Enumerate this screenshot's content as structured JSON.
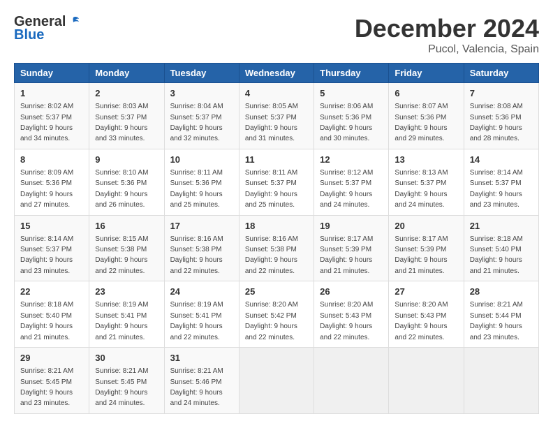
{
  "header": {
    "logo_general": "General",
    "logo_blue": "Blue",
    "month": "December 2024",
    "location": "Pucol, Valencia, Spain"
  },
  "days_of_week": [
    "Sunday",
    "Monday",
    "Tuesday",
    "Wednesday",
    "Thursday",
    "Friday",
    "Saturday"
  ],
  "weeks": [
    [
      {
        "day": "1",
        "sunrise": "8:02 AM",
        "sunset": "5:37 PM",
        "daylight": "9 hours and 34 minutes."
      },
      {
        "day": "2",
        "sunrise": "8:03 AM",
        "sunset": "5:37 PM",
        "daylight": "9 hours and 33 minutes."
      },
      {
        "day": "3",
        "sunrise": "8:04 AM",
        "sunset": "5:37 PM",
        "daylight": "9 hours and 32 minutes."
      },
      {
        "day": "4",
        "sunrise": "8:05 AM",
        "sunset": "5:37 PM",
        "daylight": "9 hours and 31 minutes."
      },
      {
        "day": "5",
        "sunrise": "8:06 AM",
        "sunset": "5:36 PM",
        "daylight": "9 hours and 30 minutes."
      },
      {
        "day": "6",
        "sunrise": "8:07 AM",
        "sunset": "5:36 PM",
        "daylight": "9 hours and 29 minutes."
      },
      {
        "day": "7",
        "sunrise": "8:08 AM",
        "sunset": "5:36 PM",
        "daylight": "9 hours and 28 minutes."
      }
    ],
    [
      {
        "day": "8",
        "sunrise": "8:09 AM",
        "sunset": "5:36 PM",
        "daylight": "9 hours and 27 minutes."
      },
      {
        "day": "9",
        "sunrise": "8:10 AM",
        "sunset": "5:36 PM",
        "daylight": "9 hours and 26 minutes."
      },
      {
        "day": "10",
        "sunrise": "8:11 AM",
        "sunset": "5:36 PM",
        "daylight": "9 hours and 25 minutes."
      },
      {
        "day": "11",
        "sunrise": "8:11 AM",
        "sunset": "5:37 PM",
        "daylight": "9 hours and 25 minutes."
      },
      {
        "day": "12",
        "sunrise": "8:12 AM",
        "sunset": "5:37 PM",
        "daylight": "9 hours and 24 minutes."
      },
      {
        "day": "13",
        "sunrise": "8:13 AM",
        "sunset": "5:37 PM",
        "daylight": "9 hours and 24 minutes."
      },
      {
        "day": "14",
        "sunrise": "8:14 AM",
        "sunset": "5:37 PM",
        "daylight": "9 hours and 23 minutes."
      }
    ],
    [
      {
        "day": "15",
        "sunrise": "8:14 AM",
        "sunset": "5:37 PM",
        "daylight": "9 hours and 23 minutes."
      },
      {
        "day": "16",
        "sunrise": "8:15 AM",
        "sunset": "5:38 PM",
        "daylight": "9 hours and 22 minutes."
      },
      {
        "day": "17",
        "sunrise": "8:16 AM",
        "sunset": "5:38 PM",
        "daylight": "9 hours and 22 minutes."
      },
      {
        "day": "18",
        "sunrise": "8:16 AM",
        "sunset": "5:38 PM",
        "daylight": "9 hours and 22 minutes."
      },
      {
        "day": "19",
        "sunrise": "8:17 AM",
        "sunset": "5:39 PM",
        "daylight": "9 hours and 21 minutes."
      },
      {
        "day": "20",
        "sunrise": "8:17 AM",
        "sunset": "5:39 PM",
        "daylight": "9 hours and 21 minutes."
      },
      {
        "day": "21",
        "sunrise": "8:18 AM",
        "sunset": "5:40 PM",
        "daylight": "9 hours and 21 minutes."
      }
    ],
    [
      {
        "day": "22",
        "sunrise": "8:18 AM",
        "sunset": "5:40 PM",
        "daylight": "9 hours and 21 minutes."
      },
      {
        "day": "23",
        "sunrise": "8:19 AM",
        "sunset": "5:41 PM",
        "daylight": "9 hours and 21 minutes."
      },
      {
        "day": "24",
        "sunrise": "8:19 AM",
        "sunset": "5:41 PM",
        "daylight": "9 hours and 22 minutes."
      },
      {
        "day": "25",
        "sunrise": "8:20 AM",
        "sunset": "5:42 PM",
        "daylight": "9 hours and 22 minutes."
      },
      {
        "day": "26",
        "sunrise": "8:20 AM",
        "sunset": "5:43 PM",
        "daylight": "9 hours and 22 minutes."
      },
      {
        "day": "27",
        "sunrise": "8:20 AM",
        "sunset": "5:43 PM",
        "daylight": "9 hours and 22 minutes."
      },
      {
        "day": "28",
        "sunrise": "8:21 AM",
        "sunset": "5:44 PM",
        "daylight": "9 hours and 23 minutes."
      }
    ],
    [
      {
        "day": "29",
        "sunrise": "8:21 AM",
        "sunset": "5:45 PM",
        "daylight": "9 hours and 23 minutes."
      },
      {
        "day": "30",
        "sunrise": "8:21 AM",
        "sunset": "5:45 PM",
        "daylight": "9 hours and 24 minutes."
      },
      {
        "day": "31",
        "sunrise": "8:21 AM",
        "sunset": "5:46 PM",
        "daylight": "9 hours and 24 minutes."
      },
      null,
      null,
      null,
      null
    ]
  ],
  "labels": {
    "sunrise": "Sunrise:",
    "sunset": "Sunset:",
    "daylight": "Daylight:"
  }
}
